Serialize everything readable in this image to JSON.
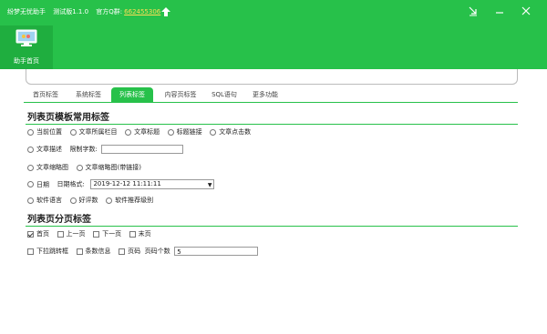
{
  "titlebar": {
    "app_name": "纷梦无忧助手",
    "version": "测试版1.1.0",
    "qq_label": "官方Q群:",
    "qq_number": "662455306"
  },
  "toolbar": {
    "assistant_home": "助手首页"
  },
  "tabs": [
    "首页标签",
    "系统标签",
    "列表标签",
    "内容页标签",
    "SQL语句",
    "更多功能"
  ],
  "section1": {
    "title": "列表页模板常用标签",
    "row1": [
      "当前位置",
      "文章所属栏目",
      "文章标题",
      "标题链接",
      "文章点击数"
    ],
    "row2": {
      "label": "文章描述",
      "limit_label": "限制字数:",
      "limit_value": ""
    },
    "row3": [
      "文章缩略图",
      "文章缩略图(带链接)"
    ],
    "row4": {
      "label": "日期",
      "format_label": "日期格式:",
      "format_value": "2019-12-12 11:11:11"
    },
    "row5": [
      "软件语言",
      "好评数",
      "软件推荐级别"
    ]
  },
  "section2": {
    "title": "列表页分页标签",
    "row1": [
      "首页",
      "上一页",
      "下一页",
      "末页"
    ],
    "row2": {
      "options": [
        "下拉跳转框",
        "条数信息",
        "页码"
      ],
      "count_label": "页码个数",
      "count_value": "5"
    }
  },
  "colors": {
    "accent": "#27c14a"
  }
}
